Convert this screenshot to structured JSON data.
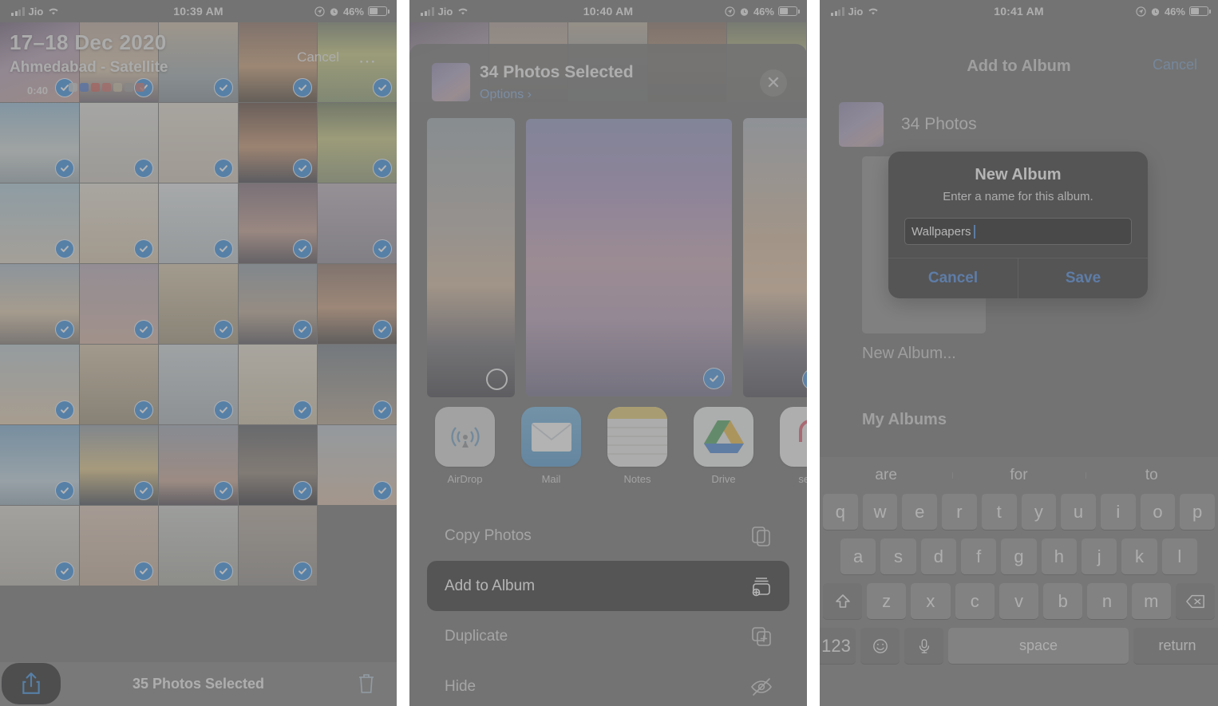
{
  "panels": [
    {
      "status": {
        "carrier": "Jio",
        "time": "10:39 AM",
        "battery": "46%"
      },
      "header": {
        "date_range": "17–18 Dec 2020",
        "location": "Ahmedabad - Satellite",
        "duration": "0:40",
        "cancel_label": "Cancel",
        "more_label": "…"
      },
      "toolbar": {
        "selection_label": "35 Photos Selected"
      }
    },
    {
      "status": {
        "carrier": "Jio",
        "time": "10:40 AM",
        "battery": "46%"
      },
      "sheet": {
        "title": "34 Photos Selected",
        "options_label": "Options ›",
        "apps": [
          {
            "label": "AirDrop",
            "icon": "airdrop-icon"
          },
          {
            "label": "Mail",
            "icon": "mail-icon"
          },
          {
            "label": "Notes",
            "icon": "notes-icon"
          },
          {
            "label": "Drive",
            "icon": "drive-icon"
          },
          {
            "label": "send",
            "icon": "sendanywhere-icon"
          }
        ],
        "actions": [
          {
            "label": "Copy Photos",
            "icon": "copy-icon",
            "highlighted": false
          },
          {
            "label": "Add to Album",
            "icon": "add-to-album-icon",
            "highlighted": true
          },
          {
            "label": "Duplicate",
            "icon": "duplicate-icon",
            "highlighted": false
          },
          {
            "label": "Hide",
            "icon": "hide-icon",
            "highlighted": false
          }
        ]
      }
    },
    {
      "status": {
        "carrier": "Jio",
        "time": "10:41 AM",
        "battery": "46%"
      },
      "nav": {
        "title": "Add to Album",
        "cancel_label": "Cancel"
      },
      "summary": {
        "count_label": "34 Photos"
      },
      "album_tile_label": "New Album...",
      "section_label": "My Albums",
      "alert": {
        "title": "New Album",
        "message": "Enter a name for this album.",
        "field_value": "Wallpapers",
        "cancel_label": "Cancel",
        "save_label": "Save"
      },
      "keyboard": {
        "suggestions": [
          "are",
          "for",
          "to"
        ],
        "row1": [
          "q",
          "w",
          "e",
          "r",
          "t",
          "y",
          "u",
          "i",
          "o",
          "p"
        ],
        "row2": [
          "a",
          "s",
          "d",
          "f",
          "g",
          "h",
          "j",
          "k",
          "l"
        ],
        "row3": [
          "z",
          "x",
          "c",
          "v",
          "b",
          "n",
          "m"
        ],
        "shift_icon": "shift-icon",
        "backspace_icon": "backspace-icon",
        "numeric_label": "123",
        "emoji_icon": "emoji-icon",
        "mic_icon": "microphone-icon",
        "space_label": "space",
        "return_label": "return"
      }
    }
  ],
  "colors": {
    "accent_blue": "#3d8ede",
    "alert_blue": "#3f83e0",
    "highlight_dark": "#2c2c2e"
  }
}
